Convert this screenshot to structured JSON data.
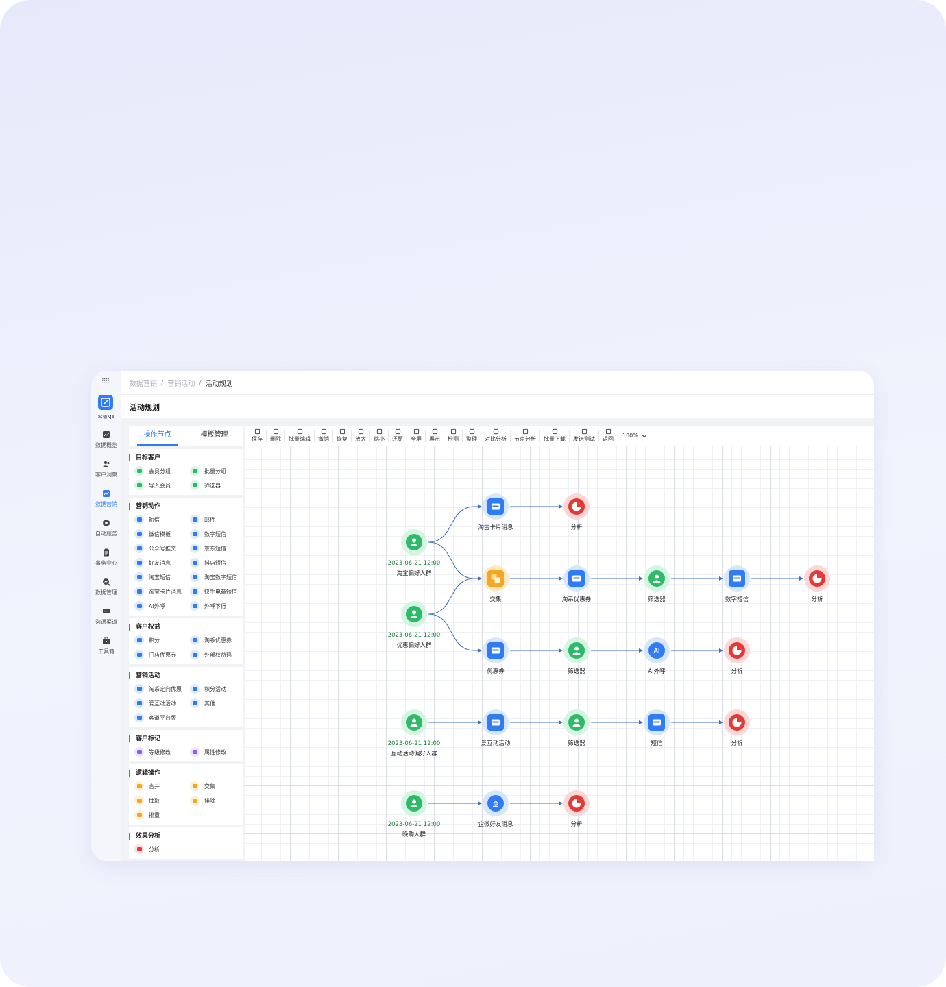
{
  "app": {
    "logo_label": "客道MA",
    "grid_glyph": "⠿⠿",
    "nav": [
      {
        "label": "数据概览",
        "icon": "chart-line-icon",
        "active": false
      },
      {
        "label": "客户洞察",
        "icon": "users-icon",
        "active": false
      },
      {
        "label": "数据营销",
        "icon": "marketing-chart-icon",
        "active": true
      },
      {
        "label": "自动服务",
        "icon": "hexagon-icon",
        "active": false
      },
      {
        "label": "事务中心",
        "icon": "clipboard-icon",
        "active": false
      },
      {
        "label": "数据管理",
        "icon": "search-data-icon",
        "active": false
      },
      {
        "label": "沟通渠道",
        "icon": "chat-icon",
        "active": false
      },
      {
        "label": "工具箱",
        "icon": "toolbox-icon",
        "active": false
      }
    ]
  },
  "breadcrumb": {
    "items": [
      "数据营销",
      "营销活动",
      "活动规划"
    ],
    "separator": "/"
  },
  "page_title": "活动规划",
  "panel": {
    "tabs": [
      "操作节点",
      "模板管理"
    ],
    "sections": [
      {
        "title": "目标客户",
        "items": [
          {
            "label": "会员分组",
            "color": "#2dbb6a",
            "bg": "#d9f5e5"
          },
          {
            "label": "批量分组",
            "color": "#2dbb6a",
            "bg": "#d9f5e5"
          },
          {
            "label": "导入会员",
            "color": "#2dbb6a",
            "bg": "#d9f5e5"
          },
          {
            "label": "筛选器",
            "color": "#2dbb6a",
            "bg": "#d9f5e5"
          }
        ]
      },
      {
        "title": "营销动作",
        "items": [
          {
            "label": "短信",
            "color": "#2f7cf6",
            "bg": "#dde9fd"
          },
          {
            "label": "邮件",
            "color": "#2f7cf6",
            "bg": "#dde9fd"
          },
          {
            "label": "微信模板",
            "color": "#2f7cf6",
            "bg": "#dde9fd"
          },
          {
            "label": "数字短信",
            "color": "#2f7cf6",
            "bg": "#dde9fd"
          },
          {
            "label": "公众号推文",
            "color": "#2f7cf6",
            "bg": "#dde9fd"
          },
          {
            "label": "京东短信",
            "color": "#2f7cf6",
            "bg": "#dde9fd"
          },
          {
            "label": "好友消息",
            "color": "#2f7cf6",
            "bg": "#dde9fd"
          },
          {
            "label": "抖店短信",
            "color": "#2f7cf6",
            "bg": "#dde9fd"
          },
          {
            "label": "淘宝短信",
            "color": "#2f7cf6",
            "bg": "#dde9fd"
          },
          {
            "label": "淘宝数字短信",
            "color": "#2f7cf6",
            "bg": "#dde9fd"
          },
          {
            "label": "淘宝卡片消息",
            "color": "#2f7cf6",
            "bg": "#dde9fd"
          },
          {
            "label": "快手电商短信",
            "color": "#2f7cf6",
            "bg": "#dde9fd"
          },
          {
            "label": "AI外呼",
            "color": "#2f7cf6",
            "bg": "#dde9fd"
          },
          {
            "label": "外呼下行",
            "color": "#2f7cf6",
            "bg": "#dde9fd"
          }
        ]
      },
      {
        "title": "客户权益",
        "items": [
          {
            "label": "积分",
            "color": "#2f7cf6",
            "bg": "#dde9fd"
          },
          {
            "label": "淘系优惠券",
            "color": "#2f7cf6",
            "bg": "#dde9fd"
          },
          {
            "label": "门店优惠券",
            "color": "#2f7cf6",
            "bg": "#dde9fd"
          },
          {
            "label": "外部权益码",
            "color": "#2f7cf6",
            "bg": "#dde9fd"
          }
        ]
      },
      {
        "title": "营销活动",
        "items": [
          {
            "label": "淘系定向优惠",
            "color": "#2f7cf6",
            "bg": "#dde9fd"
          },
          {
            "label": "积分活动",
            "color": "#2f7cf6",
            "bg": "#dde9fd"
          },
          {
            "label": "爱互动活动",
            "color": "#2f7cf6",
            "bg": "#dde9fd"
          },
          {
            "label": "其他",
            "color": "#2f7cf6",
            "bg": "#dde9fd"
          },
          {
            "label": "客道平台版",
            "color": "#2f7cf6",
            "bg": "#dde9fd"
          }
        ]
      },
      {
        "title": "客户标记",
        "items": [
          {
            "label": "等级修改",
            "color": "#8b5cf6",
            "bg": "#ece4fd"
          },
          {
            "label": "属性修改",
            "color": "#8b5cf6",
            "bg": "#ece4fd"
          }
        ]
      },
      {
        "title": "逻辑操作",
        "items": [
          {
            "label": "合并",
            "color": "#f5a623",
            "bg": "#fdf0d6"
          },
          {
            "label": "交集",
            "color": "#f5a623",
            "bg": "#fdf0d6"
          },
          {
            "label": "抽取",
            "color": "#f5a623",
            "bg": "#fdf0d6"
          },
          {
            "label": "排除",
            "color": "#f5a623",
            "bg": "#fdf0d6"
          },
          {
            "label": "排重",
            "color": "#f5a623",
            "bg": "#fdf0d6"
          }
        ]
      },
      {
        "title": "效果分析",
        "items": [
          {
            "label": "分析",
            "color": "#e53935",
            "bg": "#fde0e0"
          }
        ]
      }
    ]
  },
  "toolbar": {
    "buttons": [
      "保存",
      "删除",
      "批量编辑",
      "撤销",
      "恢复",
      "放大",
      "缩小",
      "还原",
      "全屏",
      "展示",
      "检测",
      "整理",
      "对比分析",
      "节点分析",
      "批量下载",
      "发送测试",
      "返回"
    ],
    "zoom": "100%"
  },
  "flow": {
    "nodes": [
      {
        "id": "g1",
        "type": "group",
        "date": "2023-06-21 12:00",
        "label": "淘宝偏好人群"
      },
      {
        "id": "g2",
        "type": "group",
        "date": "2023-06-21 12:00",
        "label": "优惠偏好人群"
      },
      {
        "id": "g3",
        "type": "group",
        "date": "2023-06-21 12:00",
        "label": "互动活动偏好人群"
      },
      {
        "id": "g4",
        "type": "group",
        "date": "2023-06-21 12:00",
        "label": "晚购人群"
      },
      {
        "id": "n1",
        "type": "action",
        "icon": "card-message-icon",
        "label": "淘宝卡片消息"
      },
      {
        "id": "n2",
        "type": "analysis",
        "icon": "pie-icon",
        "label": "分析"
      },
      {
        "id": "n3",
        "type": "logic",
        "icon": "intersect-icon",
        "label": "交集"
      },
      {
        "id": "n4",
        "type": "action",
        "icon": "coupon-icon",
        "label": "淘系优惠券"
      },
      {
        "id": "n5",
        "type": "filter",
        "icon": "filter-person-icon",
        "label": "筛选器"
      },
      {
        "id": "n6",
        "type": "action",
        "icon": "video-sms-icon",
        "label": "数字短信"
      },
      {
        "id": "n7",
        "type": "analysis",
        "icon": "pie-icon",
        "label": "分析"
      },
      {
        "id": "n8",
        "type": "action",
        "icon": "ticket-icon",
        "label": "优惠券"
      },
      {
        "id": "n9",
        "type": "filter",
        "icon": "filter-person-icon",
        "label": "筛选器"
      },
      {
        "id": "n10",
        "type": "action",
        "icon": "ai-call-icon",
        "label": "AI外呼",
        "badge": "AI"
      },
      {
        "id": "n11",
        "type": "analysis",
        "icon": "pie-icon",
        "label": "分析"
      },
      {
        "id": "n12",
        "type": "action",
        "icon": "interaction-icon",
        "label": "爱互动活动"
      },
      {
        "id": "n13",
        "type": "filter",
        "icon": "filter-person-icon",
        "label": "筛选器"
      },
      {
        "id": "n14",
        "type": "action",
        "icon": "sms-icon",
        "label": "短信"
      },
      {
        "id": "n15",
        "type": "analysis",
        "icon": "pie-icon",
        "label": "分析"
      },
      {
        "id": "n16",
        "type": "action",
        "icon": "wecom-icon",
        "label": "企微好友消息",
        "badge": "企"
      },
      {
        "id": "n17",
        "type": "analysis",
        "icon": "pie-icon",
        "label": "分析"
      }
    ],
    "edges": [
      [
        "g1",
        "n1"
      ],
      [
        "n1",
        "n2"
      ],
      [
        "g1",
        "n3"
      ],
      [
        "g2",
        "n3"
      ],
      [
        "n3",
        "n4"
      ],
      [
        "n4",
        "n5"
      ],
      [
        "n5",
        "n6"
      ],
      [
        "n6",
        "n7"
      ],
      [
        "g2",
        "n8"
      ],
      [
        "n8",
        "n9"
      ],
      [
        "n9",
        "n10"
      ],
      [
        "n10",
        "n11"
      ],
      [
        "g3",
        "n12"
      ],
      [
        "n12",
        "n13"
      ],
      [
        "n13",
        "n14"
      ],
      [
        "n14",
        "n15"
      ],
      [
        "g4",
        "n16"
      ],
      [
        "n16",
        "n17"
      ]
    ]
  },
  "colors": {
    "accent": "#2f7cf6",
    "group": "#2dbb6a",
    "analysis": "#e53935",
    "logic": "#f5a623",
    "edge": "#3d6fb0"
  }
}
